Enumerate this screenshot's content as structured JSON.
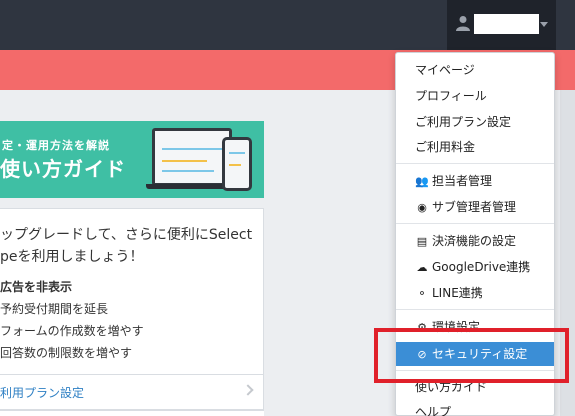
{
  "header": {
    "user_name": "",
    "user_icon": "user-icon",
    "caret_icon": "caret-down-icon"
  },
  "guide_banner": {
    "subtitle": "定・運用方法を解説",
    "title": "使い方ガイド"
  },
  "upgrade": {
    "line1": "ップグレードして、さらに便利にSelect",
    "line2": "peを利用しましょう！",
    "features": [
      "広告を非表示",
      "予約受付期間を延長",
      "フォームの作成数を増やす",
      "回答数の制限数を増やす"
    ],
    "plan_link": "利用プラン設定"
  },
  "dropdown": {
    "group1": [
      "マイページ",
      "プロフィール",
      "ご利用プラン設定",
      "ご利用料金"
    ],
    "group2": [
      {
        "label": "担当者管理",
        "icon": "users-icon"
      },
      {
        "label": "サブ管理者管理",
        "icon": "user-circle-icon"
      }
    ],
    "group3": [
      {
        "label": "決済機能の設定",
        "icon": "credit-card-icon"
      },
      {
        "label": "GoogleDrive連携",
        "icon": "cloud-icon"
      },
      {
        "label": "LINE連携",
        "icon": "chat-icon"
      }
    ],
    "group4": [
      {
        "label": "環境設定",
        "icon": "gear-icon"
      },
      {
        "label": "セキュリティ設定",
        "icon": "ban-icon"
      }
    ],
    "group5": [
      "使い方ガイド",
      "ヘルプ"
    ]
  },
  "colors": {
    "navbar": "#2f3540",
    "notice": "#f36a6a",
    "accent": "#3b8ed6",
    "guide": "#3fbfa4",
    "highlight": "#e0202a"
  }
}
